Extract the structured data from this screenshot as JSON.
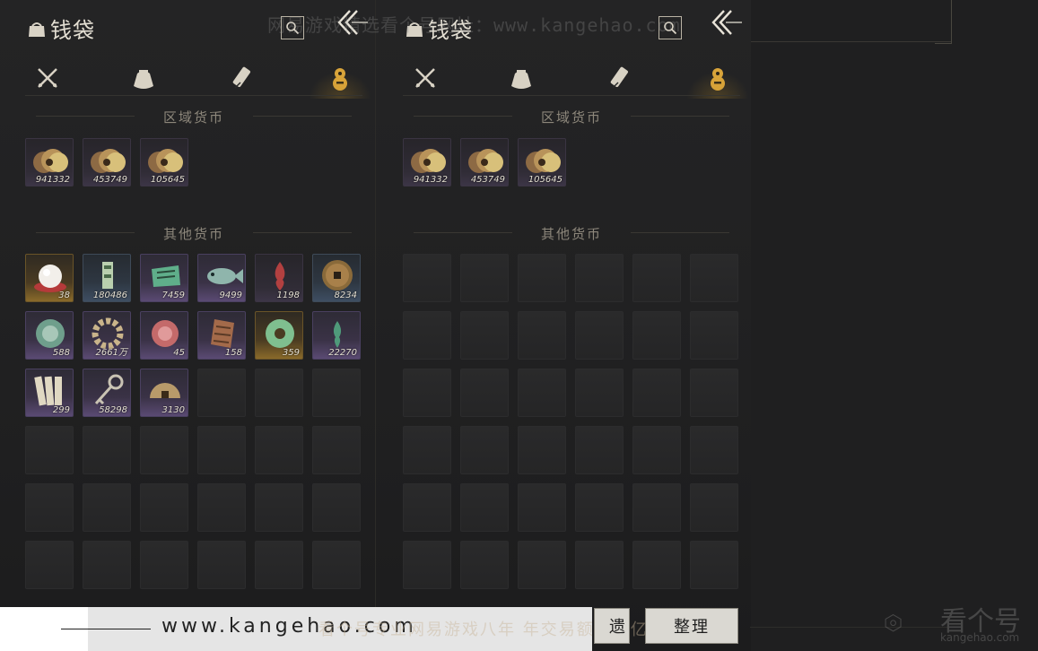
{
  "panel_left": {
    "title": "钱袋",
    "region_title": "区域货币",
    "other_title": "其他货币",
    "region_items": [
      {
        "icon": "coins-icon",
        "count": "941332",
        "rarity": "r-dark"
      },
      {
        "icon": "coins-icon",
        "count": "453749",
        "rarity": "r-dark"
      },
      {
        "icon": "coins-icon",
        "count": "105645",
        "rarity": "r-dark"
      }
    ],
    "other_items": [
      {
        "icon": "pearl-icon",
        "count": "38",
        "rarity": "r-gold"
      },
      {
        "icon": "jade-token-icon",
        "count": "180486",
        "rarity": "r-blue"
      },
      {
        "icon": "jade-slip-icon",
        "count": "7459",
        "rarity": "r-purple"
      },
      {
        "icon": "fish-icon",
        "count": "9499",
        "rarity": "r-purple"
      },
      {
        "icon": "flame-icon",
        "count": "1198",
        "rarity": "r-dark"
      },
      {
        "icon": "bronze-coin-icon",
        "count": "8234",
        "rarity": "r-blue"
      },
      {
        "icon": "jade-disc-icon",
        "count": "588",
        "rarity": "r-purple"
      },
      {
        "icon": "bracelet-icon",
        "count": "2661万",
        "rarity": "r-purple"
      },
      {
        "icon": "rose-stone-icon",
        "count": "45",
        "rarity": "r-purple"
      },
      {
        "icon": "lattice-stone-icon",
        "count": "158",
        "rarity": "r-purple"
      },
      {
        "icon": "jade-ring-icon",
        "count": "359",
        "rarity": "r-gold"
      },
      {
        "icon": "green-flame-icon",
        "count": "22270",
        "rarity": "r-purple"
      },
      {
        "icon": "bamboo-slips-icon",
        "count": "299",
        "rarity": "r-purple"
      },
      {
        "icon": "key-icon",
        "count": "58298",
        "rarity": "r-purple"
      },
      {
        "icon": "half-coin-icon",
        "count": "3130",
        "rarity": "r-purple"
      }
    ]
  },
  "panel_right": {
    "title": "钱袋",
    "region_title": "区域货币",
    "other_title": "其他货币",
    "region_items": [
      {
        "icon": "coins-icon",
        "count": "941332",
        "rarity": "r-dark"
      },
      {
        "icon": "coins-icon",
        "count": "453749",
        "rarity": "r-dark"
      },
      {
        "icon": "coins-icon",
        "count": "105645",
        "rarity": "r-dark"
      }
    ]
  },
  "tabs": [
    {
      "icon": "crossed-swords-icon"
    },
    {
      "icon": "money-pouch-icon"
    },
    {
      "icon": "scroll-icon"
    },
    {
      "icon": "gourd-icon"
    }
  ],
  "watermark": "网易游戏精选看个号网址：www.kangehao.com",
  "footer": {
    "url": "www.kangehao.com",
    "slogan": "看个号专业网易游戏八年  年交易额超过亿",
    "sort_button": "整理",
    "other_button": "遗"
  },
  "brand": {
    "name": "看个号",
    "url": "kangehao.com"
  },
  "colors": {
    "accent_gold": "#d9a43a",
    "purple_rarity": "#5a4a73",
    "gold_rarity": "#8a6a2a"
  }
}
